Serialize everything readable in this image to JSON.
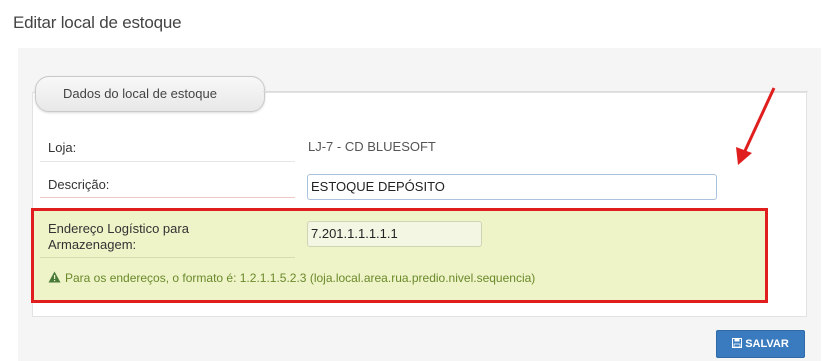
{
  "page": {
    "title": "Editar local de estoque"
  },
  "section": {
    "tab_label": "Dados do local de estoque"
  },
  "form": {
    "loja_label": "Loja:",
    "loja_value": "LJ-7 - CD BLUESOFT",
    "descricao_label": "Descrição:",
    "descricao_value": "ESTOQUE DEPÓSITO",
    "endereco_label_line1": "Endereço Logístico para",
    "endereco_label_line2": "Armazenagem:",
    "endereco_value": "7.201.1.1.1.1.1",
    "hint": "Para os endereços, o formato é: 1.2.1.1.5.2.3 (loja.local.area.rua.predio.nivel.sequencia)"
  },
  "actions": {
    "save_label": "SALVAR"
  },
  "colors": {
    "accent": "#3a7bbf",
    "highlight_border": "#e01e1e",
    "highlight_bg": "#eef3c8",
    "hint": "#6a8a2a"
  },
  "icons": {
    "hint": "warning-icon",
    "save": "floppy-disk-icon",
    "annotation": "red-arrow-icon"
  }
}
